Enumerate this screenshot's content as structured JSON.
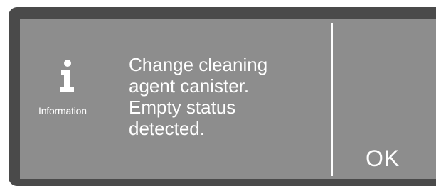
{
  "dialog": {
    "icon_name": "info-icon",
    "icon_caption": "Information",
    "message_lines": [
      "Change cleaning",
      "agent canister.",
      "Empty status",
      "detected."
    ],
    "ok_label": "OK"
  },
  "colors": {
    "bezel": "#4a4a4a",
    "screen": "#8d8d8d",
    "text": "#ffffff"
  }
}
